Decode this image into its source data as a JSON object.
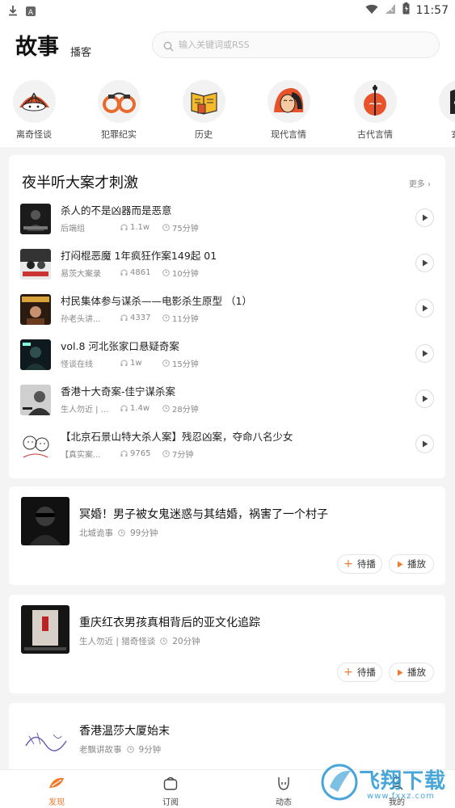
{
  "status_bar": {
    "time": "11:57"
  },
  "header": {
    "title": "故事",
    "subtitle": "播客",
    "search_placeholder": "输入关键词或RSS"
  },
  "categories": [
    {
      "label": "离奇怪谈",
      "icon": "fan-mask-icon"
    },
    {
      "label": "犯罪纪实",
      "icon": "handcuffs-icon"
    },
    {
      "label": "历史",
      "icon": "scroll-book-icon"
    },
    {
      "label": "现代言情",
      "icon": "kiss-face-icon"
    },
    {
      "label": "古代言情",
      "icon": "guqin-couple-icon"
    },
    {
      "label": "玄幻",
      "icon": "fantasy-icon"
    }
  ],
  "section": {
    "title": "夜半听大案才刺激",
    "more": "更多",
    "episodes": [
      {
        "title": "杀人的不是凶器而是恶意",
        "author": "后端组",
        "plays": "1.1w",
        "duration": "75分钟"
      },
      {
        "title": "打闷棍恶魔 1年疯狂作案149起 01",
        "author": "易茨大案录",
        "plays": "4861",
        "duration": "10分钟"
      },
      {
        "title": "村民集体参与谋杀——电影杀生原型 （1）",
        "author": "孙老头讲...",
        "plays": "4337",
        "duration": "11分钟"
      },
      {
        "title": "vol.8 河北张家口悬疑奇案",
        "author": "怪谈在线",
        "plays": "1w",
        "duration": "15分钟"
      },
      {
        "title": "香港十大奇案-佳宁谋杀案",
        "author": "生人勿近 | ...",
        "plays": "1.4w",
        "duration": "28分钟"
      },
      {
        "title": "【北京石景山特大杀人案】残忍凶案，夺命八名少女",
        "author": "【真实案...",
        "plays": "9765",
        "duration": "7分钟"
      }
    ]
  },
  "feed": [
    {
      "title": "冥婚！男子被女鬼迷惑与其结婚，祸害了一个村子",
      "author": "北城诡事",
      "duration": "99分钟",
      "queue_label": "待播",
      "play_label": "播放"
    },
    {
      "title": "重庆红衣男孩真相背后的亚文化追踪",
      "author": "生人勿近 | 猎奇怪谈",
      "duration": "20分钟",
      "queue_label": "待播",
      "play_label": "播放"
    },
    {
      "title": "香港温莎大厦始末",
      "author": "老飘讲故事",
      "duration": "9分钟"
    }
  ],
  "bottom_nav": [
    {
      "label": "发现",
      "active": true
    },
    {
      "label": "订阅",
      "active": false
    },
    {
      "label": "动态",
      "active": false
    },
    {
      "label": "我的",
      "active": false
    }
  ],
  "watermark": {
    "text": "飞翔下载",
    "url": "www.fxxz.com"
  },
  "colors": {
    "accent": "#f07a2e"
  }
}
